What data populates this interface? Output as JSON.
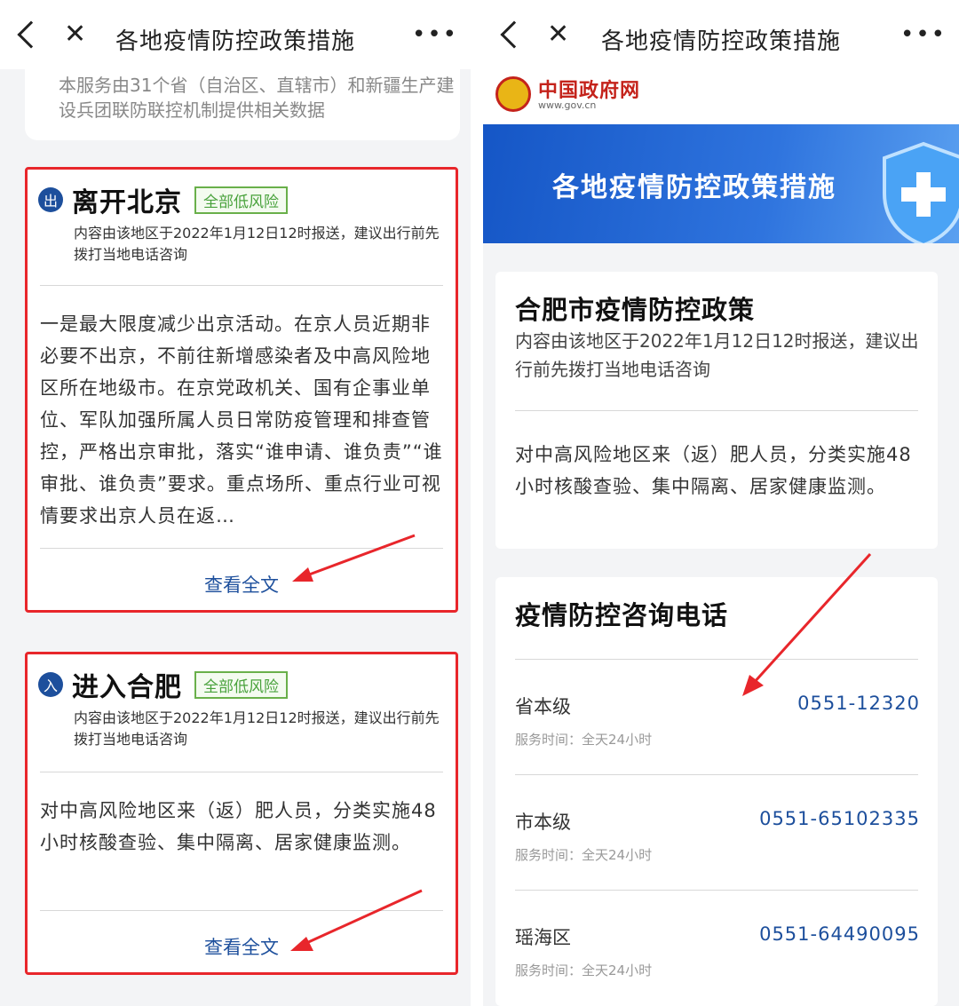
{
  "left": {
    "topbar": {
      "title": "各地疫情防控政策措施",
      "close": "✕",
      "more": "•••"
    },
    "intro": "本服务由31个省（自治区、直辖市）和新疆生产建设兵团联防联控机制提供相关数据",
    "cards": [
      {
        "icon": "出",
        "title": "离开北京",
        "badge": "全部低风险",
        "sub": "内容由该地区于2022年1月12日12时报送，建议出行前先拨打当地电话咨询",
        "body": "一是最大限度减少出京活动。在京人员近期非必要不出京，不前往新增感染者及中高风险地区所在地级市。在京党政机关、国有企事业单位、军队加强所属人员日常防疫管理和排查管控，严格出京审批，落实“谁申请、谁负责”“谁审批、谁负责”要求。重点场所、重点行业可视情要求出京人员在返…",
        "view_full": "查看全文"
      },
      {
        "icon": "入",
        "title": "进入合肥",
        "badge": "全部低风险",
        "sub": "内容由该地区于2022年1月12日12时报送，建议出行前先拨打当地电话咨询",
        "body": "对中高风险地区来（返）肥人员，分类实施48小时核酸查验、集中隔离、居家健康监测。",
        "view_full": "查看全文"
      }
    ]
  },
  "right": {
    "topbar": {
      "title": "各地疫情防控政策措施",
      "close": "✕",
      "more": "•••"
    },
    "gov_name": "中国政府网",
    "gov_url": "www.gov.cn",
    "banner_title": "各地疫情防控政策措施",
    "policy": {
      "title": "合肥市疫情防控政策",
      "sub": "内容由该地区于2022年1月12日12时报送，建议出行前先拨打当地电话咨询",
      "body": "对中高风险地区来（返）肥人员，分类实施48小时核酸查验、集中隔离、居家健康监测。"
    },
    "phones": {
      "title": "疫情防控咨询电话",
      "items": [
        {
          "level": "省本级",
          "number": "0551-12320",
          "hours": "服务时间：全天24小时"
        },
        {
          "level": "市本级",
          "number": "0551-65102335",
          "hours": "服务时间：全天24小时"
        },
        {
          "level": "瑶海区",
          "number": "0551-64490095",
          "hours": "服务时间：全天24小时"
        }
      ]
    }
  },
  "colors": {
    "highlight": "#e8262b",
    "link": "#1d4f9c",
    "badge": "#49a23c",
    "gov_red": "#c4231b"
  }
}
